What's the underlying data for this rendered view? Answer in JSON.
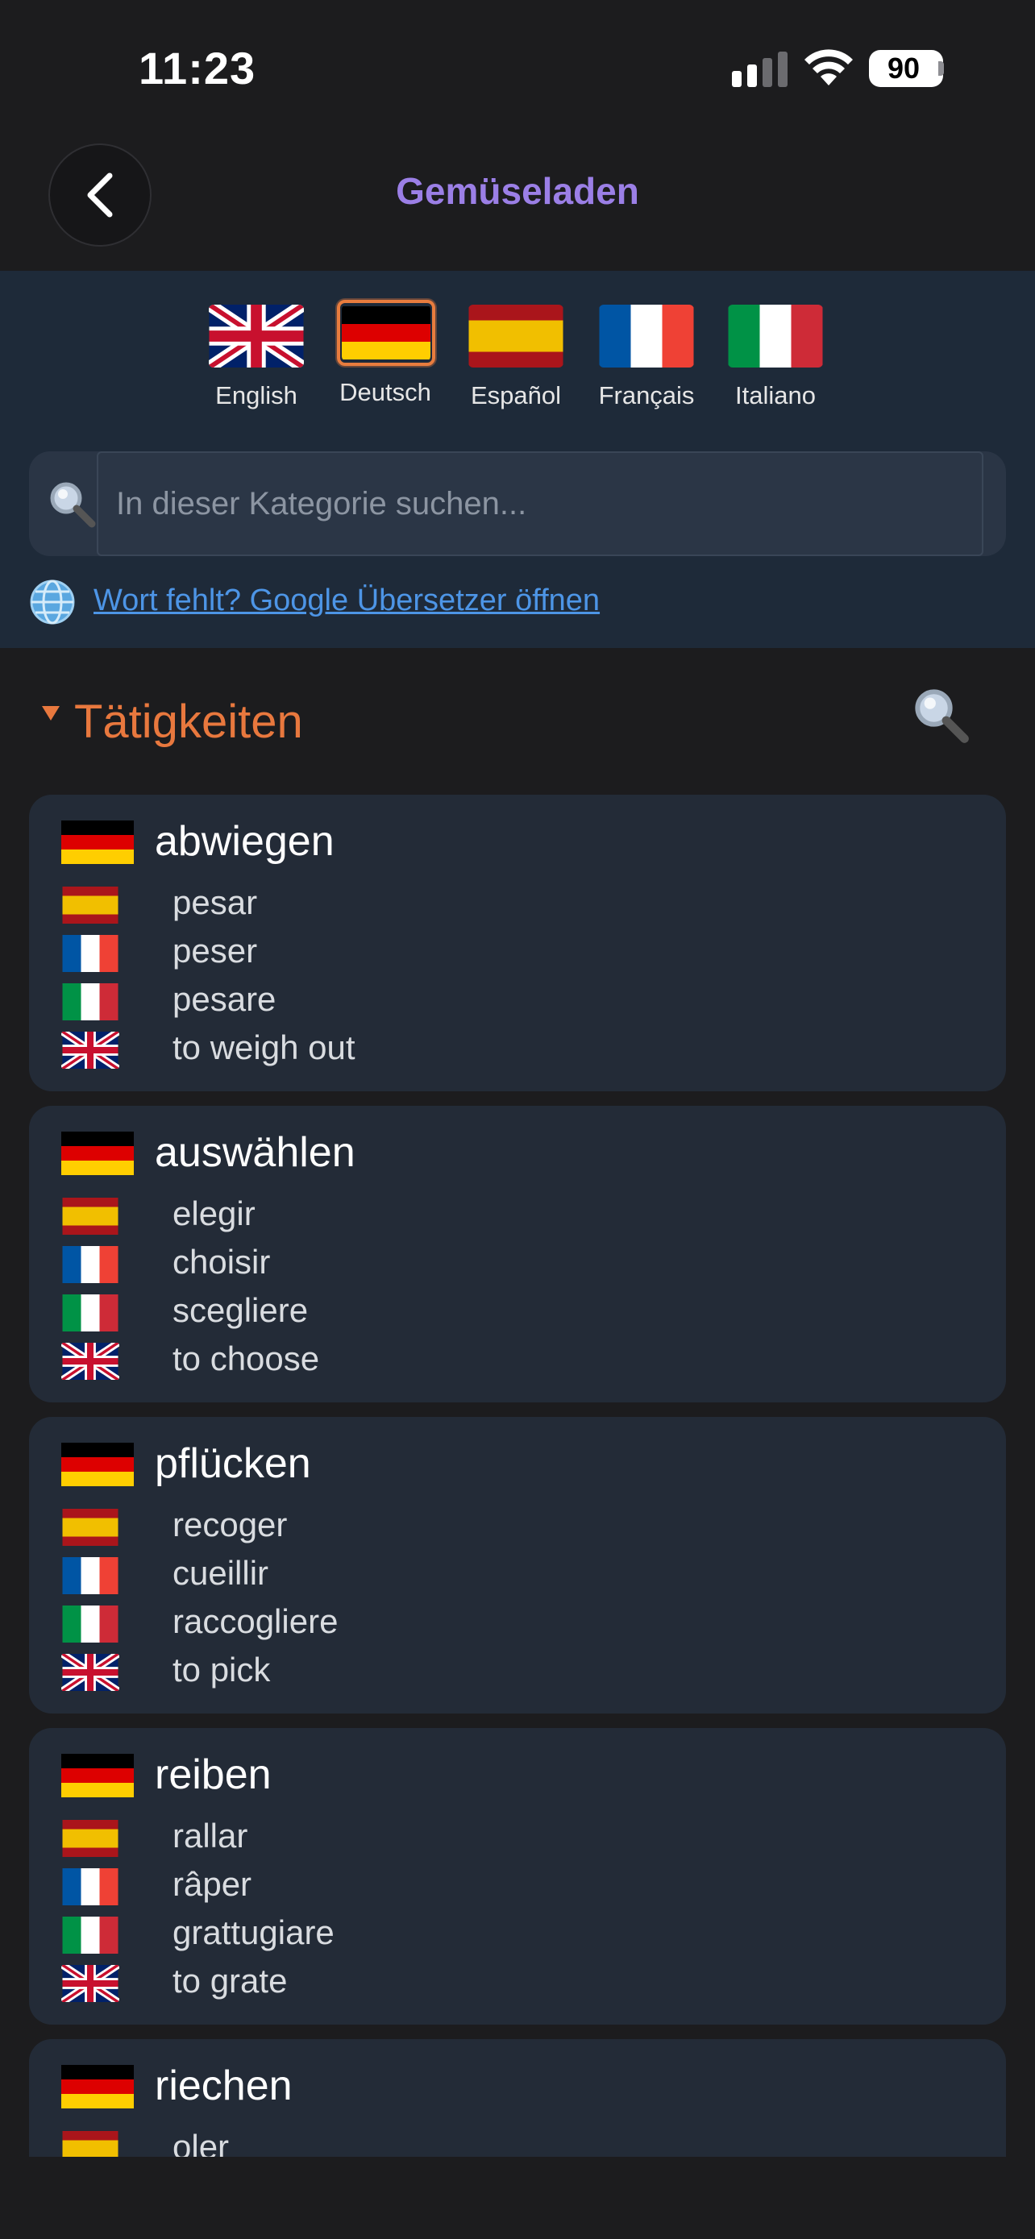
{
  "status": {
    "time": "11:23",
    "battery": "90"
  },
  "nav": {
    "title": "Gemüseladen"
  },
  "languages": [
    {
      "label": "English",
      "flag": "uk",
      "selected": false
    },
    {
      "label": "Deutsch",
      "flag": "de",
      "selected": true
    },
    {
      "label": "Español",
      "flag": "es",
      "selected": false
    },
    {
      "label": "Français",
      "flag": "fr",
      "selected": false
    },
    {
      "label": "Italiano",
      "flag": "it",
      "selected": false
    }
  ],
  "search": {
    "placeholder": "In dieser Kategorie suchen..."
  },
  "translate_link": "Wort fehlt? Google Übersetzer öffnen",
  "section": {
    "title": "Tätigkeiten"
  },
  "cards": [
    {
      "main": "abwiegen",
      "es": "pesar",
      "fr": "peser",
      "it": "pesare",
      "en": "to weigh out"
    },
    {
      "main": "auswählen",
      "es": "elegir",
      "fr": "choisir",
      "it": "scegliere",
      "en": "to choose"
    },
    {
      "main": "pflücken",
      "es": "recoger",
      "fr": "cueillir",
      "it": "raccogliere",
      "en": "to pick"
    },
    {
      "main": "reiben",
      "es": "rallar",
      "fr": "râper",
      "it": "grattugiare",
      "en": "to grate"
    },
    {
      "main": "riechen",
      "es": "oler"
    }
  ],
  "colors": {
    "accent_purple": "#9b7fe6",
    "accent_orange": "#e8783e",
    "link_blue": "#4d95e6"
  }
}
